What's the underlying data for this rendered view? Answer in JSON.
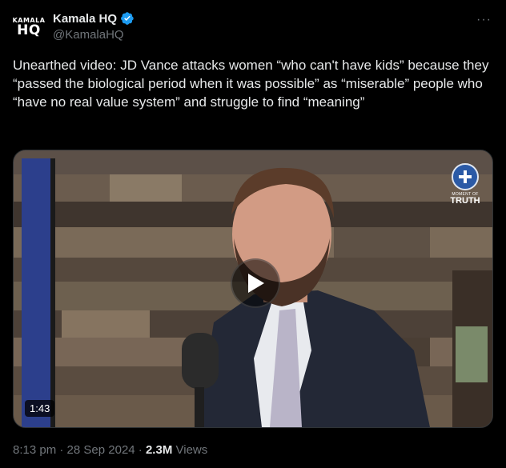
{
  "account": {
    "avatar_top": "KAMALA",
    "avatar_bottom": "HQ",
    "name": "Kamala HQ",
    "handle": "@KamalaHQ",
    "verified": true,
    "verified_color": "#1d9bf0"
  },
  "more_label": "···",
  "tweet": {
    "text": "Unearthed video: JD Vance attacks women “who can't have kids” because they “passed the biological period when it was possible” as “miserable” people who “have no real value system” and struggle to find “meaning”"
  },
  "media": {
    "duration": "1:43",
    "watermark_small": "MOMENT OF",
    "watermark_big": "TRUTH",
    "play_icon": "play-icon"
  },
  "meta": {
    "time": "8:13 pm",
    "sep1": "·",
    "date": "28 Sep 2024",
    "sep2": "·",
    "views_count": "2.3M",
    "views_label": "Views"
  },
  "colors": {
    "background": "#000000",
    "text": "#e7e9ea",
    "secondary": "#71767b",
    "border": "#2f3336"
  }
}
